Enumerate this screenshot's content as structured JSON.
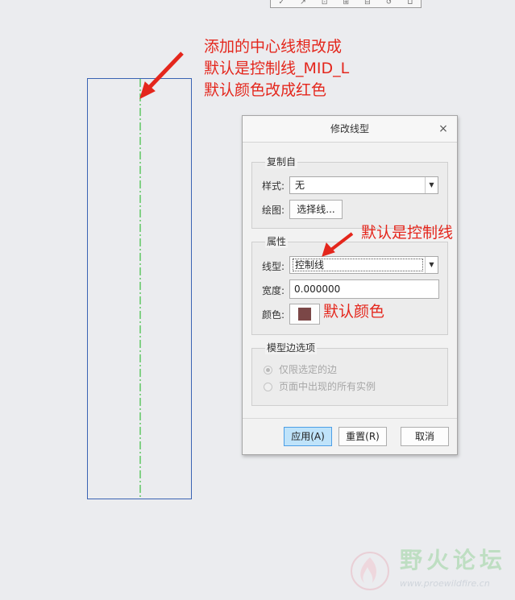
{
  "top_toolbar": {
    "glyphs": [
      "✓",
      "↗",
      "⊡",
      "⊞",
      "⊟",
      "↺",
      "⊔"
    ]
  },
  "annotations": {
    "top": [
      "添加的中心线想改成",
      "默认是控制线_MID_L",
      "默认颜色改成红色"
    ],
    "linetype": "默认是控制线",
    "color": "默认颜色",
    "color_hex": "#e4261c"
  },
  "drawing": {
    "rect_color": "#3a63b3",
    "centerline_color": "#19b51d"
  },
  "dialog": {
    "title": "修改线型",
    "close_glyph": "×",
    "copy_from": {
      "group_title": "复制自",
      "style_label": "样式:",
      "style_value": "无",
      "drawing_label": "绘图:",
      "select_line_button": "选择线..."
    },
    "properties": {
      "group_title": "属性",
      "linetype_label": "线型:",
      "linetype_value": "控制线",
      "width_label": "宽度:",
      "width_value": "0.000000",
      "color_label": "颜色:",
      "color_swatch": "#7b4747"
    },
    "model_edge": {
      "group_title": "模型边选项",
      "option1": "仅限选定的边",
      "option2": "页面中出现的所有实例",
      "selected": "option1"
    },
    "buttons": {
      "apply": "应用(A)",
      "reset": "重置(R)",
      "cancel": "取消"
    }
  },
  "watermark": {
    "name": "野火论坛",
    "url": "www.proewildfire.cn"
  }
}
